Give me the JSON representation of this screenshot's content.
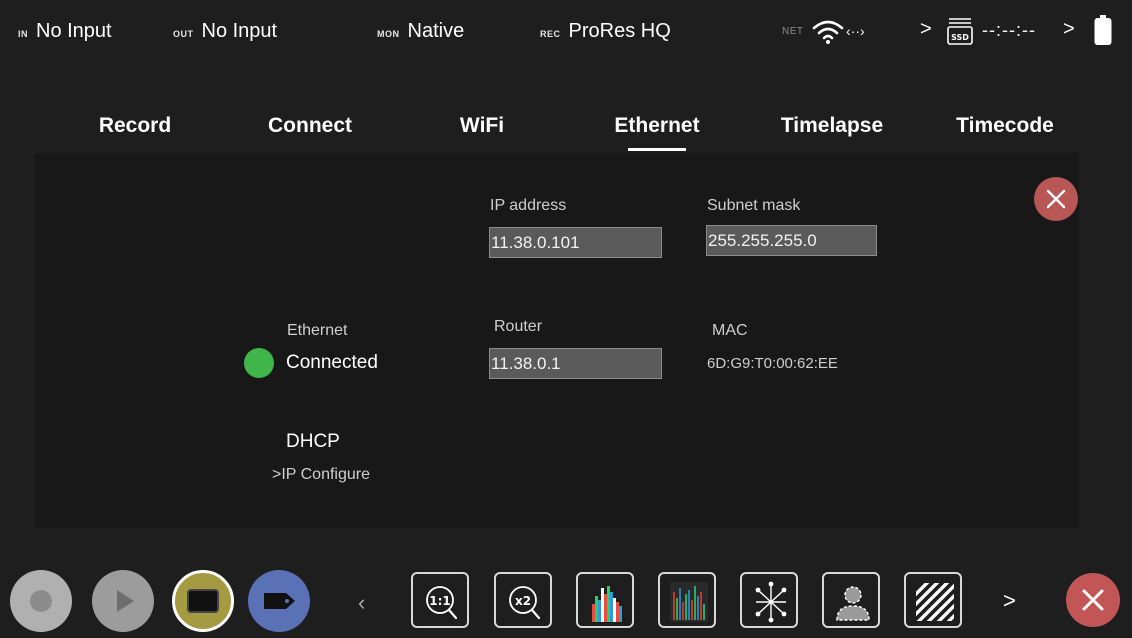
{
  "status_bar": {
    "input_tag": "IN",
    "input_value": "No Input",
    "output_tag": "OUT",
    "output_value": "No Input",
    "monitor_tag": "MON",
    "monitor_value": "Native",
    "record_tag": "REC",
    "record_value": "ProRes HQ",
    "network_tag": "NET",
    "network_arrows": "‹··›",
    "media_label": "SSD",
    "media_time": "--:--:--",
    "chevron": ">"
  },
  "tabs": [
    {
      "label": "Record"
    },
    {
      "label": "Connect"
    },
    {
      "label": "WiFi"
    },
    {
      "label": "Ethernet",
      "active": true
    },
    {
      "label": "Timelapse"
    },
    {
      "label": "Timecode"
    }
  ],
  "ethernet": {
    "ip_label": "IP address",
    "ip_value": "11.38.0.101",
    "subnet_label": "Subnet mask",
    "subnet_value": "255.255.255.0",
    "router_label": "Router",
    "router_value": "11.38.0.1",
    "mac_label": "MAC",
    "mac_value": "6D:G9:T0:00:62:EE",
    "status_label": "Ethernet",
    "status_value": "Connected",
    "dhcp_label": "DHCP",
    "ip_configure_link": ">IP Configure"
  },
  "toolbar": {
    "prev": "‹",
    "next": ">",
    "zoom_1_1": "1:1",
    "zoom_x2": "x2"
  },
  "colors": {
    "connected": "#3fb54a",
    "close": "#c25555",
    "tag_button": "#5b71b6",
    "frame_button": "#a39a42"
  }
}
